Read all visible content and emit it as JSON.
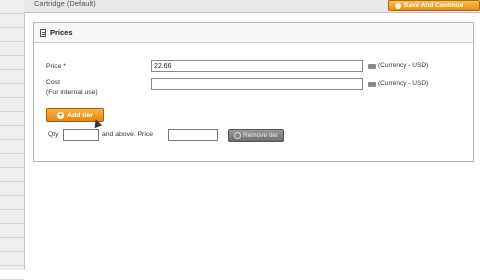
{
  "header": {
    "title": "Cartridge (Default)",
    "save_continue_label": "Save And Continue"
  },
  "prices_panel": {
    "title": "Prices",
    "price": {
      "label": "Price *",
      "value": "22.66",
      "currency": "(Currency - USD)"
    },
    "cost": {
      "label": "Cost",
      "sublabel": "(For internal use)",
      "value": "",
      "currency": "(Currency - USD)"
    },
    "add_tier_label": "Add tier",
    "tier_row": {
      "qty_label": "Qty",
      "qty_value": "",
      "and_above_label": "and above. Price",
      "price_value": "",
      "remove_label": "Remove tier"
    }
  }
}
